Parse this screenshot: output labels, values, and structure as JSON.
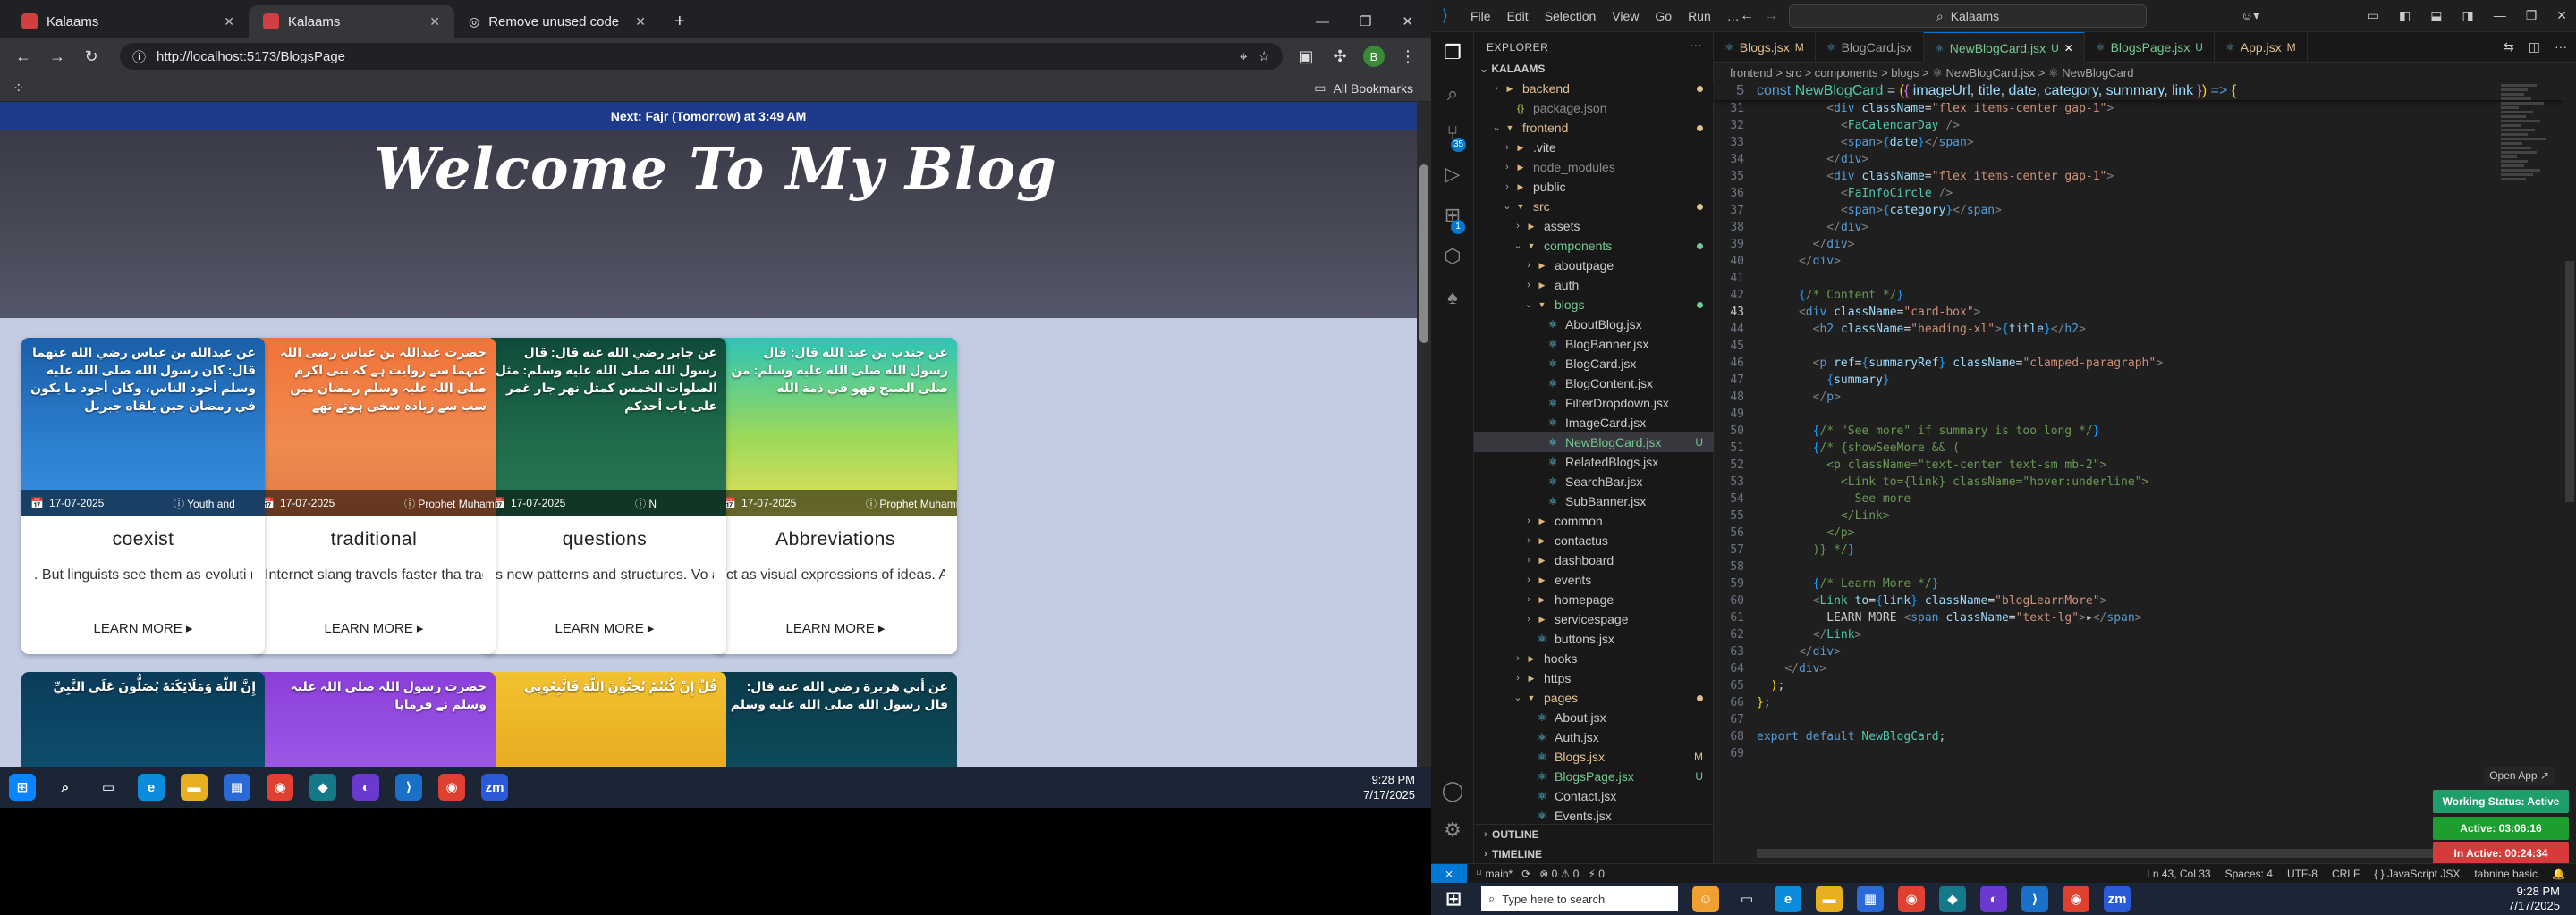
{
  "browser": {
    "tabs": [
      {
        "label": "Kalaams",
        "active": false
      },
      {
        "label": "Kalaams",
        "active": true
      },
      {
        "label": "Remove unused code",
        "active": false
      }
    ],
    "url": "http://localhost:5173/BlogsPage",
    "bookmarks_label": "All Bookmarks",
    "profile_initial": "B"
  },
  "page": {
    "prayer_banner": "Next: Fajr (Tomorrow) at 3:49 AM",
    "hero_title": "Welcome To My Blog",
    "cards": [
      {
        "date": "17-07-2025",
        "category": "Youth and",
        "title": "coexist",
        "summary": ". But linguists see them as evoluti not degradation. Digital-native",
        "more": "LEARN MORE ▸",
        "img_bg": "linear-gradient(180deg,#1a5fa8,#2d7fd0 60%,#3a8fe0)",
        "arabic": "عن عبدالله بن عباس رضي الله عنهما قال: كان رسول الله صلى الله عليه وسلم أجود الناس، وكان أجود ما يكون في رمضان حين يلقاه جبريل"
      },
      {
        "date": "17-07-2025",
        "category": "Prophet Muhammad (P",
        "title": "traditional",
        "summary": "Internet slang travels faster tha traditional dialects. Teenagers ar",
        "more": "LEARN MORE ▸",
        "img_bg": "linear-gradient(180deg,#f0743a,#f08a50 60%,#e37a46)",
        "arabic": "حضرت عبداللہ بن عباس رضی اللہ عنہما سے روایت ہے کہ نبی اکرم صلی اللہ علیہ وسلم رمضان میں سب سے زیادہ سخی ہوتے تھے"
      },
      {
        "date": "17-07-2025",
        "category": "N",
        "title": "questions",
        "summary": "s new patterns and structures. Vo assistants affect how we phrase",
        "more": "LEARN MORE ▸",
        "img_bg": "linear-gradient(180deg,#0f4a3a,#1e6a4a 55%,#2a7a55)",
        "arabic": "عن جابر رضي الله عنه قال: قال رسول الله صلى الله عليه وسلم: مثل الصلوات الخمس كمثل نهر جار غمر على باب أحدكم"
      },
      {
        "date": "17-07-2025",
        "category": "Prophet Muhammad (PBUH)",
        "title": "Abbreviations",
        "summary": "ct as visual expressions of ideas. Abbreviations like \"FOMO\" or...",
        "more": "LEARN MORE ▸",
        "img_bg": "linear-gradient(180deg,#2ec4b6,#9ad95a 55%,#e8e05a)",
        "arabic": "عن جندب بن عبد الله قال: قال رسول الله صلى الله عليه وسلم: من صلى الصبح فهو في ذمة الله"
      }
    ],
    "cards_row2": [
      {
        "img_bg": "linear-gradient(180deg,#0b3b5a,#0f5070)",
        "arabic": "إِنَّ اللَّهَ وَمَلَائِكَتَهُ يُصَلُّونَ عَلَى النَّبِيِّ"
      },
      {
        "img_bg": "linear-gradient(180deg,#8a3fd8,#a05ae8)",
        "arabic": "حضرت رسول اللہ صلی اللہ علیہ وسلم نے فرمایا"
      },
      {
        "img_bg": "linear-gradient(180deg,#f2c230,#e8a820)",
        "arabic": "قُلْ إِنْ كُنْتُمْ تُحِبُّونَ اللَّهَ فَاتَّبِعُونِي"
      },
      {
        "img_bg": "linear-gradient(180deg,#0a3a4a,#0e4d5e)",
        "arabic": "عن أبي هريرة رضي الله عنه قال: قال رسول الله صلى الله عليه وسلم"
      }
    ]
  },
  "taskbar_left": {
    "time": "9:28 PM",
    "date": "7/17/2025",
    "apps": [
      {
        "name": "windows-start",
        "glyph": "⊞",
        "color": "#0a84ff"
      },
      {
        "name": "search",
        "glyph": "⌕",
        "color": "#1c2536"
      },
      {
        "name": "task-view",
        "glyph": "▭",
        "color": "#1c2536"
      },
      {
        "name": "edge",
        "glyph": "e",
        "color": "#0c8ddc"
      },
      {
        "name": "file-explorer",
        "glyph": "▬",
        "color": "#e8b020"
      },
      {
        "name": "store",
        "glyph": "▦",
        "color": "#2a6ad8"
      },
      {
        "name": "chrome",
        "glyph": "◉",
        "color": "#e04030"
      },
      {
        "name": "app-teal",
        "glyph": "◆",
        "color": "#147a8a"
      },
      {
        "name": "github",
        "glyph": "◐",
        "color": "#6a3ad0"
      },
      {
        "name": "vscode",
        "glyph": "⟩",
        "color": "#1a70c8"
      },
      {
        "name": "chrome-2",
        "glyph": "◉",
        "color": "#e04030"
      },
      {
        "name": "zoom",
        "glyph": "zm",
        "color": "#2a5ad8"
      }
    ]
  },
  "vscode": {
    "menu": [
      "File",
      "Edit",
      "Selection",
      "View",
      "Go",
      "Run",
      "…"
    ],
    "command_center": "Kalaams",
    "explorer_title": "EXPLORER",
    "root": "KALAAMS",
    "search_badge": "35",
    "ext_badge": "1",
    "tree": [
      {
        "label": "backend",
        "depth": 1,
        "type": "folder",
        "open": false,
        "color": "mod",
        "marker": "dot"
      },
      {
        "label": "package.json",
        "depth": 2,
        "type": "json",
        "color": "ign",
        "marker": ""
      },
      {
        "label": "frontend",
        "depth": 1,
        "type": "folder",
        "open": true,
        "color": "mod",
        "marker": "dot"
      },
      {
        "label": ".vite",
        "depth": 2,
        "type": "folder",
        "open": false,
        "color": "",
        "marker": ""
      },
      {
        "label": "node_modules",
        "depth": 2,
        "type": "folder",
        "open": false,
        "color": "ign",
        "marker": ""
      },
      {
        "label": "public",
        "depth": 2,
        "type": "folder",
        "open": false,
        "color": "",
        "marker": ""
      },
      {
        "label": "src",
        "depth": 2,
        "type": "folder",
        "open": true,
        "color": "mod",
        "marker": "dot"
      },
      {
        "label": "assets",
        "depth": 3,
        "type": "folder",
        "open": false,
        "color": "",
        "marker": ""
      },
      {
        "label": "components",
        "depth": 3,
        "type": "folder",
        "open": true,
        "color": "unt",
        "marker": "dotg"
      },
      {
        "label": "aboutpage",
        "depth": 4,
        "type": "folder",
        "open": false,
        "color": "",
        "marker": ""
      },
      {
        "label": "auth",
        "depth": 4,
        "type": "folder",
        "open": false,
        "color": "",
        "marker": ""
      },
      {
        "label": "blogs",
        "depth": 4,
        "type": "folder",
        "open": true,
        "color": "unt",
        "marker": "dotg"
      },
      {
        "label": "AboutBlog.jsx",
        "depth": 5,
        "type": "jsx",
        "color": "",
        "marker": ""
      },
      {
        "label": "BlogBanner.jsx",
        "depth": 5,
        "type": "jsx",
        "color": "",
        "marker": ""
      },
      {
        "label": "BlogCard.jsx",
        "depth": 5,
        "type": "jsx",
        "color": "",
        "marker": ""
      },
      {
        "label": "BlogContent.jsx",
        "depth": 5,
        "type": "jsx",
        "color": "",
        "marker": ""
      },
      {
        "label": "FilterDropdown.jsx",
        "depth": 5,
        "type": "jsx",
        "color": "",
        "marker": ""
      },
      {
        "label": "ImageCard.jsx",
        "depth": 5,
        "type": "jsx",
        "color": "",
        "marker": ""
      },
      {
        "label": "NewBlogCard.jsx",
        "depth": 5,
        "type": "jsx",
        "color": "unt",
        "marker": "U",
        "selected": true
      },
      {
        "label": "RelatedBlogs.jsx",
        "depth": 5,
        "type": "jsx",
        "color": "",
        "marker": ""
      },
      {
        "label": "SearchBar.jsx",
        "depth": 5,
        "type": "jsx",
        "color": "",
        "marker": ""
      },
      {
        "label": "SubBanner.jsx",
        "depth": 5,
        "type": "jsx",
        "color": "",
        "marker": ""
      },
      {
        "label": "common",
        "depth": 4,
        "type": "folder",
        "open": false,
        "color": "",
        "marker": ""
      },
      {
        "label": "contactus",
        "depth": 4,
        "type": "folder",
        "open": false,
        "color": "",
        "marker": ""
      },
      {
        "label": "dashboard",
        "depth": 4,
        "type": "folder",
        "open": false,
        "color": "",
        "marker": ""
      },
      {
        "label": "events",
        "depth": 4,
        "type": "folder",
        "open": false,
        "color": "",
        "marker": ""
      },
      {
        "label": "homepage",
        "depth": 4,
        "type": "folder",
        "open": false,
        "color": "",
        "marker": ""
      },
      {
        "label": "servicespage",
        "depth": 4,
        "type": "folder",
        "open": false,
        "color": "",
        "marker": ""
      },
      {
        "label": "buttons.jsx",
        "depth": 4,
        "type": "jsx",
        "color": "",
        "marker": ""
      },
      {
        "label": "hooks",
        "depth": 3,
        "type": "folder",
        "open": false,
        "color": "",
        "marker": ""
      },
      {
        "label": "https",
        "depth": 3,
        "type": "folder",
        "open": false,
        "color": "",
        "marker": ""
      },
      {
        "label": "pages",
        "depth": 3,
        "type": "folder",
        "open": true,
        "color": "mod",
        "marker": "dot"
      },
      {
        "label": "About.jsx",
        "depth": 4,
        "type": "jsx",
        "color": "",
        "marker": ""
      },
      {
        "label": "Auth.jsx",
        "depth": 4,
        "type": "jsx",
        "color": "",
        "marker": ""
      },
      {
        "label": "Blogs.jsx",
        "depth": 4,
        "type": "jsx",
        "color": "mod",
        "marker": "M"
      },
      {
        "label": "BlogsPage.jsx",
        "depth": 4,
        "type": "jsx",
        "color": "unt",
        "marker": "U"
      },
      {
        "label": "Contact.jsx",
        "depth": 4,
        "type": "jsx",
        "color": "",
        "marker": ""
      },
      {
        "label": "Events.jsx",
        "depth": 4,
        "type": "jsx",
        "color": "",
        "marker": ""
      }
    ],
    "outline_label": "OUTLINE",
    "timeline_label": "TIMELINE",
    "tabs": [
      {
        "label": "Blogs.jsx",
        "flag": "M",
        "active": false
      },
      {
        "label": "BlogCard.jsx",
        "flag": "",
        "active": false
      },
      {
        "label": "NewBlogCard.jsx",
        "flag": "U",
        "active": true
      },
      {
        "label": "BlogsPage.jsx",
        "flag": "U",
        "active": false
      },
      {
        "label": "App.jsx",
        "flag": "M",
        "active": false
      }
    ],
    "breadcrumb": "frontend > src > components > blogs > ⚛ NewBlogCard.jsx > ⚛ NewBlogCard",
    "sticky": {
      "ln": "5",
      "html": "<span class='k'>const</span> <span class='t'>NewBlogCard</span> = <span class='b'>(</span><span class='p'>{</span> <span class='a'>imageUrl</span>, <span class='a'>title</span>, <span class='a'>date</span>, <span class='a'>category</span>, <span class='a'>summary</span>, <span class='a'>link</span> <span class='p'>}</span><span class='b'>)</span> <span class='k'>=&gt;</span> <span class='b'>{</span>"
    },
    "code": [
      {
        "ln": "31",
        "html": "          <span class='d'>&lt;</span><span class='k'>div</span> <span class='a'>className</span>=<span class='s'>\"flex items-center gap-1\"</span><span class='d'>&gt;</span>"
      },
      {
        "ln": "32",
        "html": "            <span class='d'>&lt;</span><span class='t'>FaCalendarDay</span> <span class='d'>/&gt;</span>"
      },
      {
        "ln": "33",
        "html": "            <span class='d'>&lt;</span><span class='k'>span</span><span class='d'>&gt;</span><span class='br'>{</span><span class='a'>date</span><span class='br'>}</span><span class='d'>&lt;/</span><span class='k'>span</span><span class='d'>&gt;</span>"
      },
      {
        "ln": "34",
        "html": "          <span class='d'>&lt;/</span><span class='k'>div</span><span class='d'>&gt;</span>"
      },
      {
        "ln": "35",
        "html": "          <span class='d'>&lt;</span><span class='k'>div</span> <span class='a'>className</span>=<span class='s'>\"flex items-center gap-1\"</span><span class='d'>&gt;</span>"
      },
      {
        "ln": "36",
        "html": "            <span class='d'>&lt;</span><span class='t'>FaInfoCircle</span> <span class='d'>/&gt;</span>"
      },
      {
        "ln": "37",
        "html": "            <span class='d'>&lt;</span><span class='k'>span</span><span class='d'>&gt;</span><span class='br'>{</span><span class='a'>category</span><span class='br'>}</span><span class='d'>&lt;/</span><span class='k'>span</span><span class='d'>&gt;</span>"
      },
      {
        "ln": "38",
        "html": "          <span class='d'>&lt;/</span><span class='k'>div</span><span class='d'>&gt;</span>"
      },
      {
        "ln": "39",
        "html": "        <span class='d'>&lt;/</span><span class='k'>div</span><span class='d'>&gt;</span>"
      },
      {
        "ln": "40",
        "html": "      <span class='d'>&lt;/</span><span class='k'>div</span><span class='d'>&gt;</span>"
      },
      {
        "ln": "41",
        "html": ""
      },
      {
        "ln": "42",
        "html": "      <span class='br'>{</span><span class='c'>/* Content */</span><span class='br'>}</span>"
      },
      {
        "ln": "43",
        "html": "      <span class='d'>&lt;</span><span class='k'>div</span> <span class='a'>className</span>=<span class='s'>\"card-box\"</span><span class='d'>&gt;</span>",
        "current": true
      },
      {
        "ln": "44",
        "html": "        <span class='d'>&lt;</span><span class='k'>h2</span> <span class='a'>className</span>=<span class='s'>\"heading-xl\"</span><span class='d'>&gt;</span><span class='br'>{</span><span class='a'>title</span><span class='br'>}</span><span class='d'>&lt;/</span><span class='k'>h2</span><span class='d'>&gt;</span>"
      },
      {
        "ln": "45",
        "html": ""
      },
      {
        "ln": "46",
        "html": "        <span class='d'>&lt;</span><span class='k'>p</span> <span class='a'>ref</span>=<span class='br'>{</span><span class='a'>summaryRef</span><span class='br'>}</span> <span class='a'>className</span>=<span class='s'>\"clamped-paragraph\"</span><span class='d'>&gt;</span>"
      },
      {
        "ln": "47",
        "html": "          <span class='br'>{</span><span class='a'>summary</span><span class='br'>}</span>"
      },
      {
        "ln": "48",
        "html": "        <span class='d'>&lt;/</span><span class='k'>p</span><span class='d'>&gt;</span>"
      },
      {
        "ln": "49",
        "html": ""
      },
      {
        "ln": "50",
        "html": "        <span class='br'>{</span><span class='c'>/* \"See more\" if summary is too long */</span><span class='br'>}</span>"
      },
      {
        "ln": "51",
        "html": "        <span class='br'>{</span><span class='c'>/* {showSeeMore &amp;&amp; (</span>"
      },
      {
        "ln": "52",
        "html": "<span class='c'>          &lt;p className=\"text-center text-sm mb-2\"&gt;</span>"
      },
      {
        "ln": "53",
        "html": "<span class='c'>            &lt;Link to={link} className=\"hover:underline\"&gt;</span>"
      },
      {
        "ln": "54",
        "html": "<span class='c'>              See more</span>"
      },
      {
        "ln": "55",
        "html": "<span class='c'>            &lt;/Link&gt;</span>"
      },
      {
        "ln": "56",
        "html": "<span class='c'>          &lt;/p&gt;</span>"
      },
      {
        "ln": "57",
        "html": "<span class='c'>        )} */</span><span class='br'>}</span>"
      },
      {
        "ln": "58",
        "html": ""
      },
      {
        "ln": "59",
        "html": "        <span class='br'>{</span><span class='c'>/* Learn More */</span><span class='br'>}</span>"
      },
      {
        "ln": "60",
        "html": "        <span class='d'>&lt;</span><span class='t'>Link</span> <span class='a'>to</span>=<span class='br'>{</span><span class='a'>link</span><span class='br'>}</span> <span class='a'>className</span>=<span class='s'>\"blogLearnMore\"</span><span class='d'>&gt;</span>"
      },
      {
        "ln": "61",
        "html": "          LEARN MORE <span class='d'>&lt;</span><span class='k'>span</span> <span class='a'>className</span>=<span class='s'>\"text-lg\"</span><span class='d'>&gt;</span>▸<span class='d'>&lt;/</span><span class='k'>span</span><span class='d'>&gt;</span>"
      },
      {
        "ln": "62",
        "html": "        <span class='d'>&lt;/</span><span class='t'>Link</span><span class='d'>&gt;</span>"
      },
      {
        "ln": "63",
        "html": "      <span class='d'>&lt;/</span><span class='k'>div</span><span class='d'>&gt;</span>"
      },
      {
        "ln": "64",
        "html": "    <span class='d'>&lt;/</span><span class='k'>div</span><span class='d'>&gt;</span>"
      },
      {
        "ln": "65",
        "html": "  <span class='b'>)</span>;"
      },
      {
        "ln": "66",
        "html": "<span class='b'>}</span>;"
      },
      {
        "ln": "67",
        "html": ""
      },
      {
        "ln": "68",
        "html": "<span class='k'>export</span> <span class='k'>default</span> <span class='t'>NewBlogCard</span>;"
      },
      {
        "ln": "69",
        "html": ""
      }
    ],
    "status": {
      "branch": "main*",
      "problems": "⊗ 0 ⚠ 0",
      "port": "0",
      "position": "Ln 43, Col 33",
      "spaces": "Spaces: 4",
      "encoding": "UTF-8",
      "eol": "CRLF",
      "language": "{ } JavaScript JSX",
      "extension": "tabnine basic"
    },
    "working": [
      {
        "label": "Working Status: Active",
        "color": "#1e9e6a"
      },
      {
        "label": "Active: 03:06:16",
        "color": "#1e9e2e"
      },
      {
        "label": "In Active: 00:24:34",
        "color": "#d73a3a"
      }
    ],
    "open_app": "Open App ↗"
  },
  "taskbar_right": {
    "search_placeholder": "Type here to search",
    "time": "9:28 PM",
    "date": "7/17/2025"
  }
}
